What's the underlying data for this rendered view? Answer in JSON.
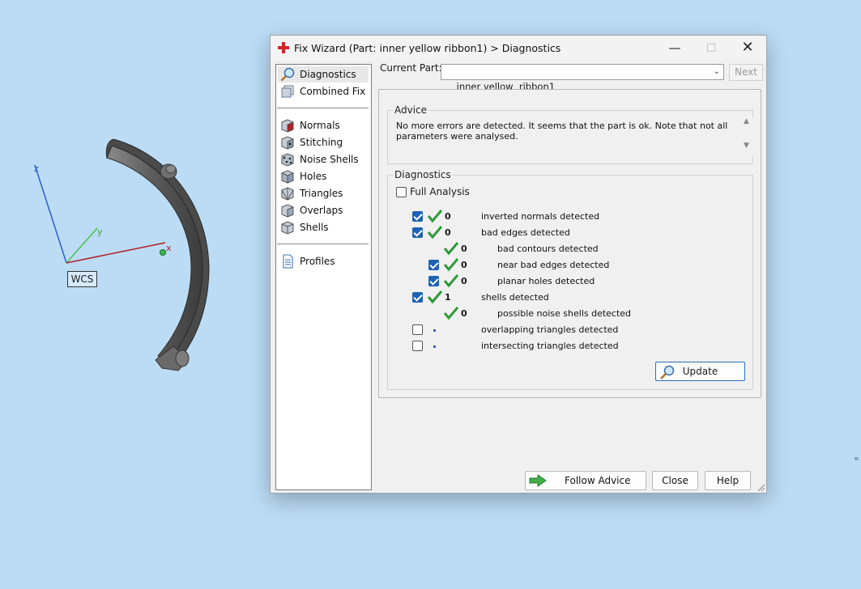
{
  "viewport": {
    "wcs_label": "WCS",
    "axis_x": "x",
    "axis_y": "y",
    "axis_z": "z",
    "edge_marker": "«"
  },
  "dialog": {
    "title": "Fix Wizard (Part: inner yellow  ribbon1) > Diagnostics",
    "window_controls": {
      "minimize": "—",
      "maximize": "□",
      "close": "✕"
    }
  },
  "nav": {
    "items": [
      {
        "label": "Diagnostics",
        "icon": "magnifier-icon",
        "selected": true
      },
      {
        "label": "Combined Fix",
        "icon": "combined-fix-icon"
      },
      {
        "label": "Normals",
        "icon": "normals-cube-icon"
      },
      {
        "label": "Stitching",
        "icon": "stitching-cube-icon"
      },
      {
        "label": "Noise Shells",
        "icon": "noise-shells-icon"
      },
      {
        "label": "Holes",
        "icon": "holes-cube-icon"
      },
      {
        "label": "Triangles",
        "icon": "triangles-cube-icon"
      },
      {
        "label": "Overlaps",
        "icon": "overlaps-cube-icon"
      },
      {
        "label": "Shells",
        "icon": "shells-cube-icon"
      },
      {
        "label": "Profiles",
        "icon": "profiles-document-icon"
      }
    ]
  },
  "current_part": {
    "label": "Current Part:",
    "value": "inner yellow  ribbon1",
    "next_label": "Next"
  },
  "advice": {
    "legend": "Advice",
    "text": "No more errors are detected. It seems that the part is ok. Note that not all parameters were analysed."
  },
  "diagnostics": {
    "legend": "Diagnostics",
    "full_analysis_label": "Full Analysis",
    "rows": [
      {
        "label": "inverted normals detected",
        "count": "0",
        "checkbox": true,
        "checked": true,
        "status": "ok"
      },
      {
        "label": "bad edges detected",
        "count": "0",
        "checkbox": true,
        "checked": true,
        "status": "ok"
      },
      {
        "label": "bad contours detected",
        "count": "0",
        "checkbox": false,
        "status": "ok"
      },
      {
        "label": "near bad edges detected",
        "count": "0",
        "checkbox": true,
        "checked": true,
        "status": "ok"
      },
      {
        "label": "planar holes detected",
        "count": "0",
        "checkbox": true,
        "checked": true,
        "status": "ok"
      },
      {
        "label": "shells detected",
        "count": "1",
        "checkbox": true,
        "checked": true,
        "status": "ok"
      },
      {
        "label": "possible noise shells detected",
        "count": "0",
        "checkbox": false,
        "status": "ok"
      },
      {
        "label": "overlapping triangles detected",
        "count": "",
        "checkbox": true,
        "checked": false,
        "status": "not-analysed"
      },
      {
        "label": "intersecting triangles detected",
        "count": "",
        "checkbox": true,
        "checked": false,
        "status": "not-analysed"
      }
    ],
    "update_label": "Update"
  },
  "buttons": {
    "follow_advice": "Follow Advice",
    "close": "Close",
    "help": "Help"
  },
  "colors": {
    "desktop": "#bcdcf5",
    "check_green": "#2e9a3a",
    "checkbox_blue": "#1d63b3",
    "accent_blue": "#2a6fb8"
  }
}
